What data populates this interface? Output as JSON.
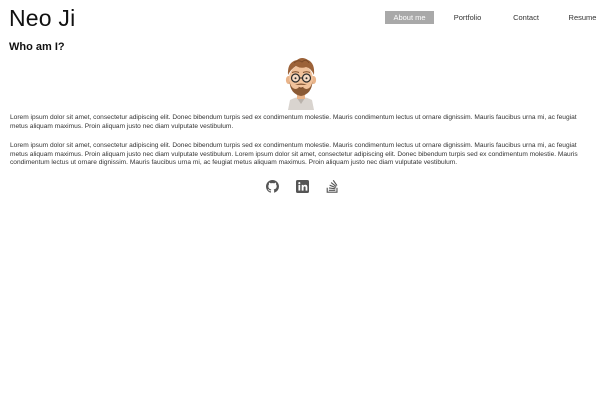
{
  "site": {
    "title": "Neo Ji"
  },
  "nav": {
    "items": [
      {
        "label": "About me",
        "active": true
      },
      {
        "label": "Portfolio",
        "active": false
      },
      {
        "label": "Contact",
        "active": false
      },
      {
        "label": "Resume",
        "active": false
      }
    ]
  },
  "about": {
    "heading": "Who am I?",
    "avatar_icon": "cartoon-avatar",
    "paragraphs": [
      "Lorem ipsum dolor sit amet, consectetur adipiscing elit. Donec bibendum turpis sed ex condimentum molestie. Mauris condimentum lectus ut ornare dignissim. Mauris faucibus urna mi, ac feugiat metus aliquam maximus. Proin aliquam justo nec diam vulputate vestibulum.",
      "Lorem ipsum dolor sit amet, consectetur adipiscing elit. Donec bibendum turpis sed ex condimentum molestie. Mauris condimentum lectus ut ornare dignissim. Mauris faucibus urna mi, ac feugiat metus aliquam maximus. Proin aliquam justo nec diam vulputate vestibulum. Lorem ipsum dolor sit amet, consectetur adipiscing elit. Donec bibendum turpis sed ex condimentum molestie. Mauris condimentum lectus ut ornare dignissim. Mauris faucibus urna mi, ac feugiat metus aliquam maximus. Proin aliquam justo nec diam vulputate vestibulum."
    ]
  },
  "social": {
    "icons": [
      "github-icon",
      "linkedin-icon",
      "stackoverflow-icon"
    ]
  },
  "colors": {
    "nav_active_bg": "#a9a9a9",
    "icon_color": "#555555",
    "text_color": "#333333"
  }
}
